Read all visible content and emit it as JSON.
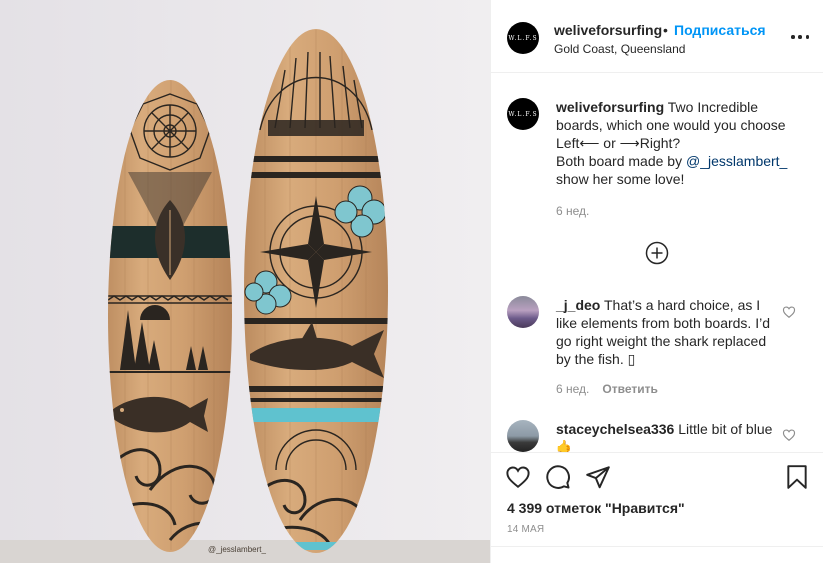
{
  "post": {
    "username": "weliveforsurfing",
    "avatar_text": "W.L.F.S",
    "dot": "•",
    "follow_label": "Подписаться",
    "location": "Gold Coast, Queensland",
    "photo_watermark": "@_jesslambert_"
  },
  "caption": {
    "username": "weliveforsurfing",
    "line1": " Two Incredible boards, which one would you choose Left⟵ or ⟶Right?",
    "line2": "Both board made by ",
    "mention": "@_jesslambert_",
    "line3": " show her some love!",
    "time": "6 нед."
  },
  "comments": [
    {
      "username": "_j_deo",
      "text": " That’s a hard choice, as I like elements from both boards. I’d go right weight the shark replaced by the fish. ▯",
      "time": "6 нед.",
      "reply_label": "Ответить"
    },
    {
      "username": "staceychelsea336",
      "text": " Little bit of blue 🤙"
    }
  ],
  "likes": "4 399 отметок \"Нравится\"",
  "date": "14 МАЯ",
  "icons": [
    "heart-icon",
    "comment-icon",
    "share-icon",
    "bookmark-icon",
    "add-comment-icon",
    "more-icon"
  ]
}
